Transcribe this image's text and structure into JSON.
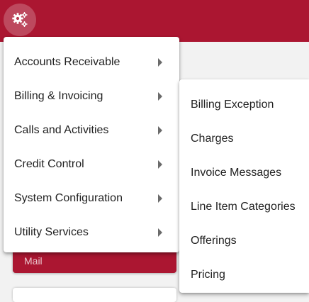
{
  "header": {
    "settings_icon": "gears-icon",
    "accent_color": "#ab1631"
  },
  "background": {
    "mail_button_label": "Mail"
  },
  "main_menu": {
    "items": [
      {
        "label": "Accounts Receivable",
        "has_submenu": true
      },
      {
        "label": "Billing & Invoicing",
        "has_submenu": true
      },
      {
        "label": "Calls and Activities",
        "has_submenu": true
      },
      {
        "label": "Credit Control",
        "has_submenu": true
      },
      {
        "label": "System Configuration",
        "has_submenu": true
      },
      {
        "label": "Utility Services",
        "has_submenu": true
      }
    ]
  },
  "submenu": {
    "parent": "Billing & Invoicing",
    "items": [
      {
        "label": "Billing Exception"
      },
      {
        "label": "Charges"
      },
      {
        "label": "Invoice Messages"
      },
      {
        "label": "Line Item Categories"
      },
      {
        "label": "Offerings"
      },
      {
        "label": "Pricing"
      }
    ]
  }
}
